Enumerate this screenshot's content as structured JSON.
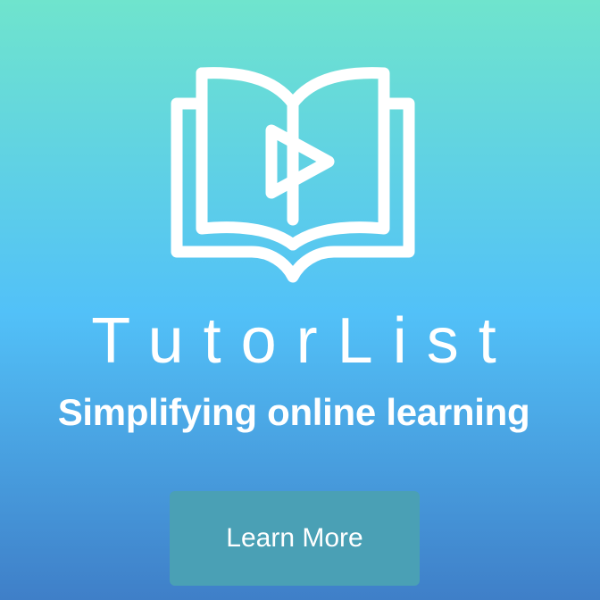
{
  "brand": {
    "name": "TutorList",
    "tagline": "Simplifying online learning"
  },
  "cta": {
    "label": "Learn More"
  },
  "icons": {
    "logo": "open-book-play-icon"
  },
  "colors": {
    "gradient_top": "#6fe4cd",
    "gradient_mid": "#52c1f8",
    "gradient_bottom": "#3f7fc8",
    "button": "#4aa0b5",
    "text": "#ffffff"
  }
}
